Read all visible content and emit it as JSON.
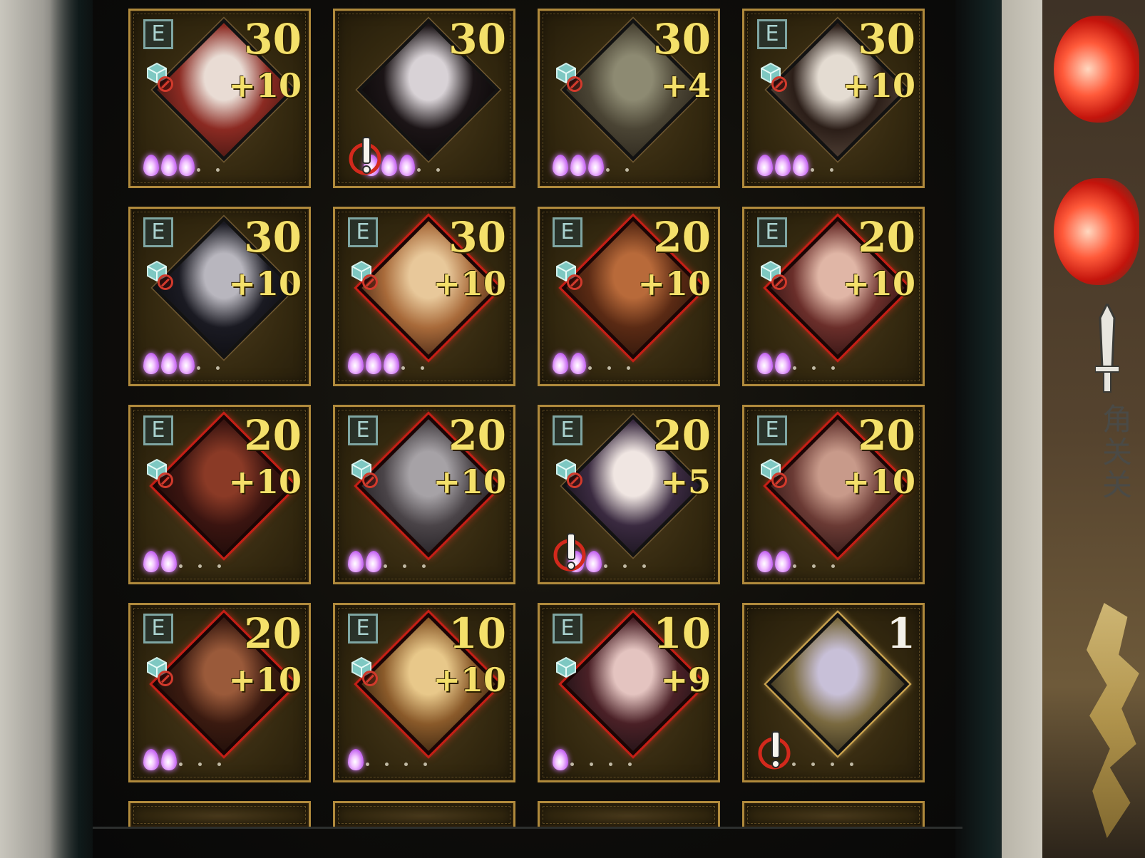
{
  "side_panel": {
    "text_lines": [
      "角",
      "关",
      "关"
    ]
  },
  "cards": [
    {
      "level": "30",
      "bonus": "+10",
      "e_badge": true,
      "gem": true,
      "ban": true,
      "alert": false,
      "flames": 3,
      "frame": "dark",
      "portrait": "pale-woman-red-hair-wounded"
    },
    {
      "level": "30",
      "bonus": "",
      "e_badge": false,
      "gem": false,
      "ban": false,
      "alert": true,
      "flames": 3,
      "frame": "dark",
      "portrait": "black-hair-woman"
    },
    {
      "level": "30",
      "bonus": "+4",
      "e_badge": false,
      "gem": true,
      "ban": true,
      "alert": false,
      "flames": 3,
      "frame": "dark",
      "portrait": "old-man-goggles"
    },
    {
      "level": "30",
      "bonus": "+10",
      "e_badge": true,
      "gem": true,
      "ban": true,
      "alert": false,
      "flames": 3,
      "frame": "dark",
      "portrait": "pale-man-headpiece"
    },
    {
      "level": "30",
      "bonus": "+10",
      "e_badge": true,
      "gem": true,
      "ban": true,
      "alert": false,
      "flames": 3,
      "frame": "dark",
      "portrait": "dark-hair-man-blue-eye"
    },
    {
      "level": "30",
      "bonus": "+10",
      "e_badge": true,
      "gem": true,
      "ban": true,
      "alert": false,
      "flames": 3,
      "frame": "red",
      "portrait": "blonde-profile"
    },
    {
      "level": "20",
      "bonus": "+10",
      "e_badge": true,
      "gem": true,
      "ban": true,
      "alert": false,
      "flames": 2,
      "frame": "red",
      "portrait": "red-hair-warrior"
    },
    {
      "level": "20",
      "bonus": "+10",
      "e_badge": true,
      "gem": true,
      "ban": true,
      "alert": false,
      "flames": 2,
      "frame": "red",
      "portrait": "long-hair-woman"
    },
    {
      "level": "20",
      "bonus": "+10",
      "e_badge": true,
      "gem": true,
      "ban": true,
      "alert": false,
      "flames": 2,
      "frame": "red",
      "portrait": "masked-figure-red"
    },
    {
      "level": "20",
      "bonus": "+10",
      "e_badge": true,
      "gem": true,
      "ban": true,
      "alert": false,
      "flames": 2,
      "frame": "red",
      "portrait": "grey-hair-man"
    },
    {
      "level": "20",
      "bonus": "+5",
      "e_badge": true,
      "gem": true,
      "ban": true,
      "alert": true,
      "flames": 2,
      "frame": "dark",
      "portrait": "crowned-woman"
    },
    {
      "level": "20",
      "bonus": "+10",
      "e_badge": true,
      "gem": true,
      "ban": true,
      "alert": false,
      "flames": 2,
      "frame": "red",
      "portrait": "bandaged-face"
    },
    {
      "level": "20",
      "bonus": "+10",
      "e_badge": true,
      "gem": true,
      "ban": true,
      "alert": false,
      "flames": 2,
      "frame": "red",
      "portrait": "ornate-headdress-woman"
    },
    {
      "level": "10",
      "bonus": "+10",
      "e_badge": true,
      "gem": true,
      "ban": true,
      "alert": false,
      "flames": 1,
      "frame": "red",
      "portrait": "blonde-man"
    },
    {
      "level": "10",
      "bonus": "+9",
      "e_badge": true,
      "gem": true,
      "ban": false,
      "alert": false,
      "flames": 1,
      "frame": "red",
      "portrait": "sleeping-woman"
    },
    {
      "level": "1",
      "bonus": "",
      "e_badge": false,
      "gem": false,
      "ban": false,
      "alert": true,
      "flames": 0,
      "frame": "gold",
      "portrait": "hooded-figure-gold",
      "level_color": "white"
    }
  ],
  "e_label": "E",
  "colors": {
    "level": "#f4e06a",
    "frame_gold": "#b08a3c",
    "frame_red": "#c41f16",
    "flame": "#c260f0",
    "badge": "#7fa6a3"
  }
}
